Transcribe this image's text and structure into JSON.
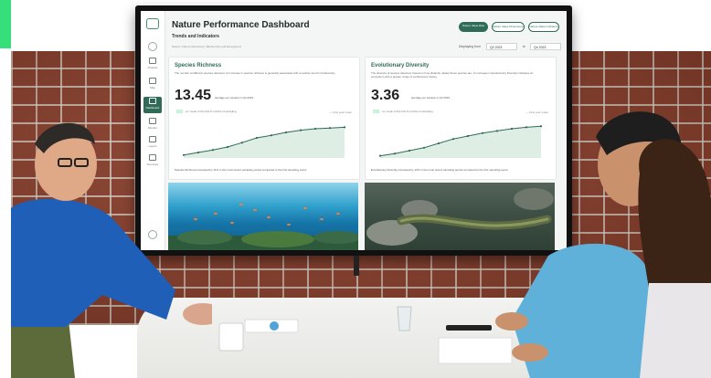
{
  "dashboard": {
    "title": "Nature Performance Dashboard",
    "subtitle": "Trends and Indicators",
    "breadcrumb": "Nature / Nature Monitoring / Biodiversity and Ecosystems",
    "pills": [
      "Nature Value Risk",
      "Nature Value Dimensions",
      "Nature Value Indicators"
    ],
    "period_label": "Displaying from",
    "period_from": "Q2 2023",
    "period_to_word": "to",
    "period_to": "Q4 2023",
    "sidebar": [
      "Projects",
      "Map",
      "Dashboard",
      "Monitor",
      "Layers",
      "Summary"
    ]
  },
  "cards": [
    {
      "title": "Species Richness",
      "description": "The number of different species detected. An increase in species richness is generally associated with a positive trend in biodiversity.",
      "value": "13.45",
      "avg": "average per sample in Q4 2023",
      "badge_text": "vs. mean of the first 6 months of sampling",
      "legend": "— First year mean",
      "footer": "Species Richness increased by 11% in the most recent sampling period compared to the first sampling event.",
      "trend": [
        0.08,
        0.15,
        0.22,
        0.3,
        0.42,
        0.55,
        0.62,
        0.7,
        0.76,
        0.8,
        0.82,
        0.84
      ]
    },
    {
      "title": "Evolutionary Diversity",
      "description": "The diversity of species detected, based on how distantly related those species are. An increase in Evolutionary Diversity indicates an ecosystem with a greater range of evolutionary history.",
      "value": "3.36",
      "avg": "average per sample in Q4 2023",
      "badge_text": "vs. mean of the first 6 months of sampling",
      "legend": "— First year mean",
      "footer": "Evolutionary Diversity increased by 10% in the most recent sampling period compared to the first sampling event.",
      "trend": [
        0.06,
        0.12,
        0.2,
        0.28,
        0.4,
        0.52,
        0.6,
        0.68,
        0.74,
        0.8,
        0.84,
        0.87
      ]
    }
  ],
  "colors": {
    "brand": "#2f6b57",
    "brick": "#8d3f2b",
    "accent": "#35e07a"
  }
}
